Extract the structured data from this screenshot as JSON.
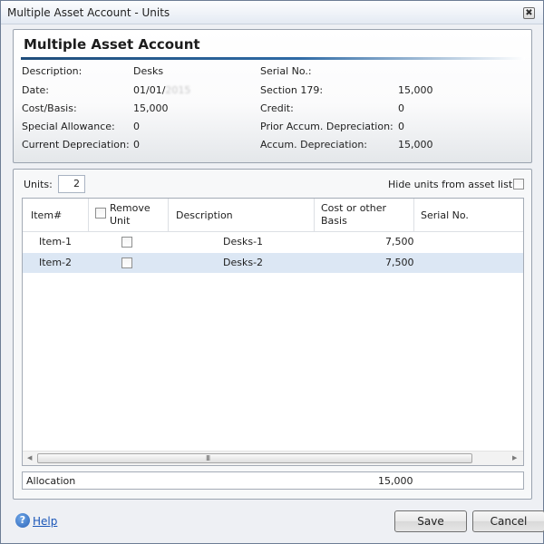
{
  "window": {
    "title": "Multiple Asset Account - Units",
    "close_glyph": "✖"
  },
  "header": {
    "title": "Multiple Asset Account",
    "left_fields": [
      {
        "label": "Description:",
        "value": "Desks"
      },
      {
        "label": "Date:",
        "value": "01/01/",
        "value_blurred": "2015"
      },
      {
        "label": "Cost/Basis:",
        "value": "15,000"
      },
      {
        "label": "Special Allowance:",
        "value": "0"
      },
      {
        "label": "Current Depreciation:",
        "value": "0"
      }
    ],
    "right_fields": [
      {
        "label": "Serial No.:",
        "value": ""
      },
      {
        "label": "Section 179:",
        "value": "15,000"
      },
      {
        "label": "Credit:",
        "value": "0"
      },
      {
        "label": "Prior Accum. Depreciation:",
        "value": "0"
      },
      {
        "label": "Accum. Depreciation:",
        "value": "15,000"
      }
    ]
  },
  "units": {
    "label": "Units:",
    "value": "2"
  },
  "hide_units": {
    "label": "Hide units from asset list",
    "checked": false
  },
  "grid": {
    "columns": {
      "item": "Item#",
      "remove_line1": "Remove",
      "remove_line2": "Unit",
      "description": "Description",
      "cost_line1": "Cost or other",
      "cost_line2": "Basis",
      "serial": "Serial No."
    },
    "rows": [
      {
        "item": "Item-1",
        "remove": false,
        "description": "Desks-1",
        "cost": "7,500",
        "serial": "",
        "selected": false
      },
      {
        "item": "Item-2",
        "remove": false,
        "description": "Desks-2",
        "cost": "7,500",
        "serial": "",
        "selected": true
      }
    ],
    "scrollbar": {
      "left_arrow": "◀",
      "right_arrow": "▶",
      "grip": "III"
    }
  },
  "allocation": {
    "label": "Allocation",
    "value": "15,000"
  },
  "footer": {
    "help_icon_glyph": "?",
    "help_label": "Help",
    "save_label": "Save",
    "cancel_label": "Cancel"
  }
}
